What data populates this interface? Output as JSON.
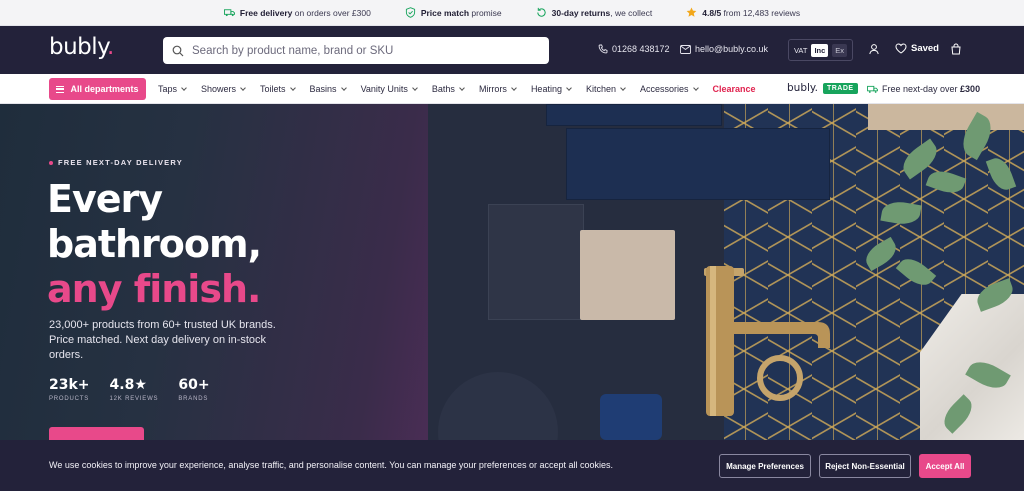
{
  "usp": [
    {
      "bold": "Free delivery",
      "rest": " on orders over £300",
      "icon": "truck-icon"
    },
    {
      "bold": "Price match",
      "rest": " promise",
      "icon": "shield-check-icon"
    },
    {
      "bold": "30-day returns",
      "rest": ", we collect",
      "icon": "return-arrow-icon"
    },
    {
      "bold": "4.8/5",
      "rest": " from 12,483 reviews",
      "icon": "star-icon"
    }
  ],
  "header": {
    "logo": "bubly",
    "logo_dot": ".",
    "search_placeholder": "Search by product name, brand or SKU",
    "phone": "01268 438172",
    "email": "hello@bubly.co.uk",
    "vat_label": "VAT",
    "vat_inc": "Inc",
    "vat_ex": "Ex",
    "saved": "Saved"
  },
  "nav": {
    "all_departments": "All departments",
    "categories": [
      "Taps",
      "Showers",
      "Toilets",
      "Basins",
      "Vanity Units",
      "Baths",
      "Mirrors",
      "Heating",
      "Kitchen",
      "Accessories"
    ],
    "clearance": "Clearance",
    "trade_logo": "bubly.",
    "trade_badge": "TRADE",
    "nextday_text": "Free next-day over ",
    "nextday_amount": "£300"
  },
  "hero": {
    "eyebrow": "FREE NEXT-DAY DELIVERY",
    "headline_line1": "Every",
    "headline_line2": "bathroom,",
    "headline_line3": "any finish.",
    "subtext": "23,000+ products from 60+ trusted UK brands. Price matched. Next day delivery on in-stock orders.",
    "stats": [
      {
        "value": "23k+",
        "label": "PRODUCTS"
      },
      {
        "value": "4.8★",
        "label": "12K REVIEWS"
      },
      {
        "value": "60+",
        "label": "BRANDS"
      }
    ]
  },
  "cookie": {
    "text": "We use cookies to improve your experience, analyse traffic, and personalise content. You can manage your preferences or accept all cookies.",
    "manage": "Manage Preferences",
    "reject": "Reject Non-Essential",
    "accept": "Accept All"
  },
  "colors": {
    "brand_pink": "#e8498a",
    "header_navy": "#23223a",
    "trade_green": "#17a45c",
    "clearance_red": "#e0234f"
  }
}
